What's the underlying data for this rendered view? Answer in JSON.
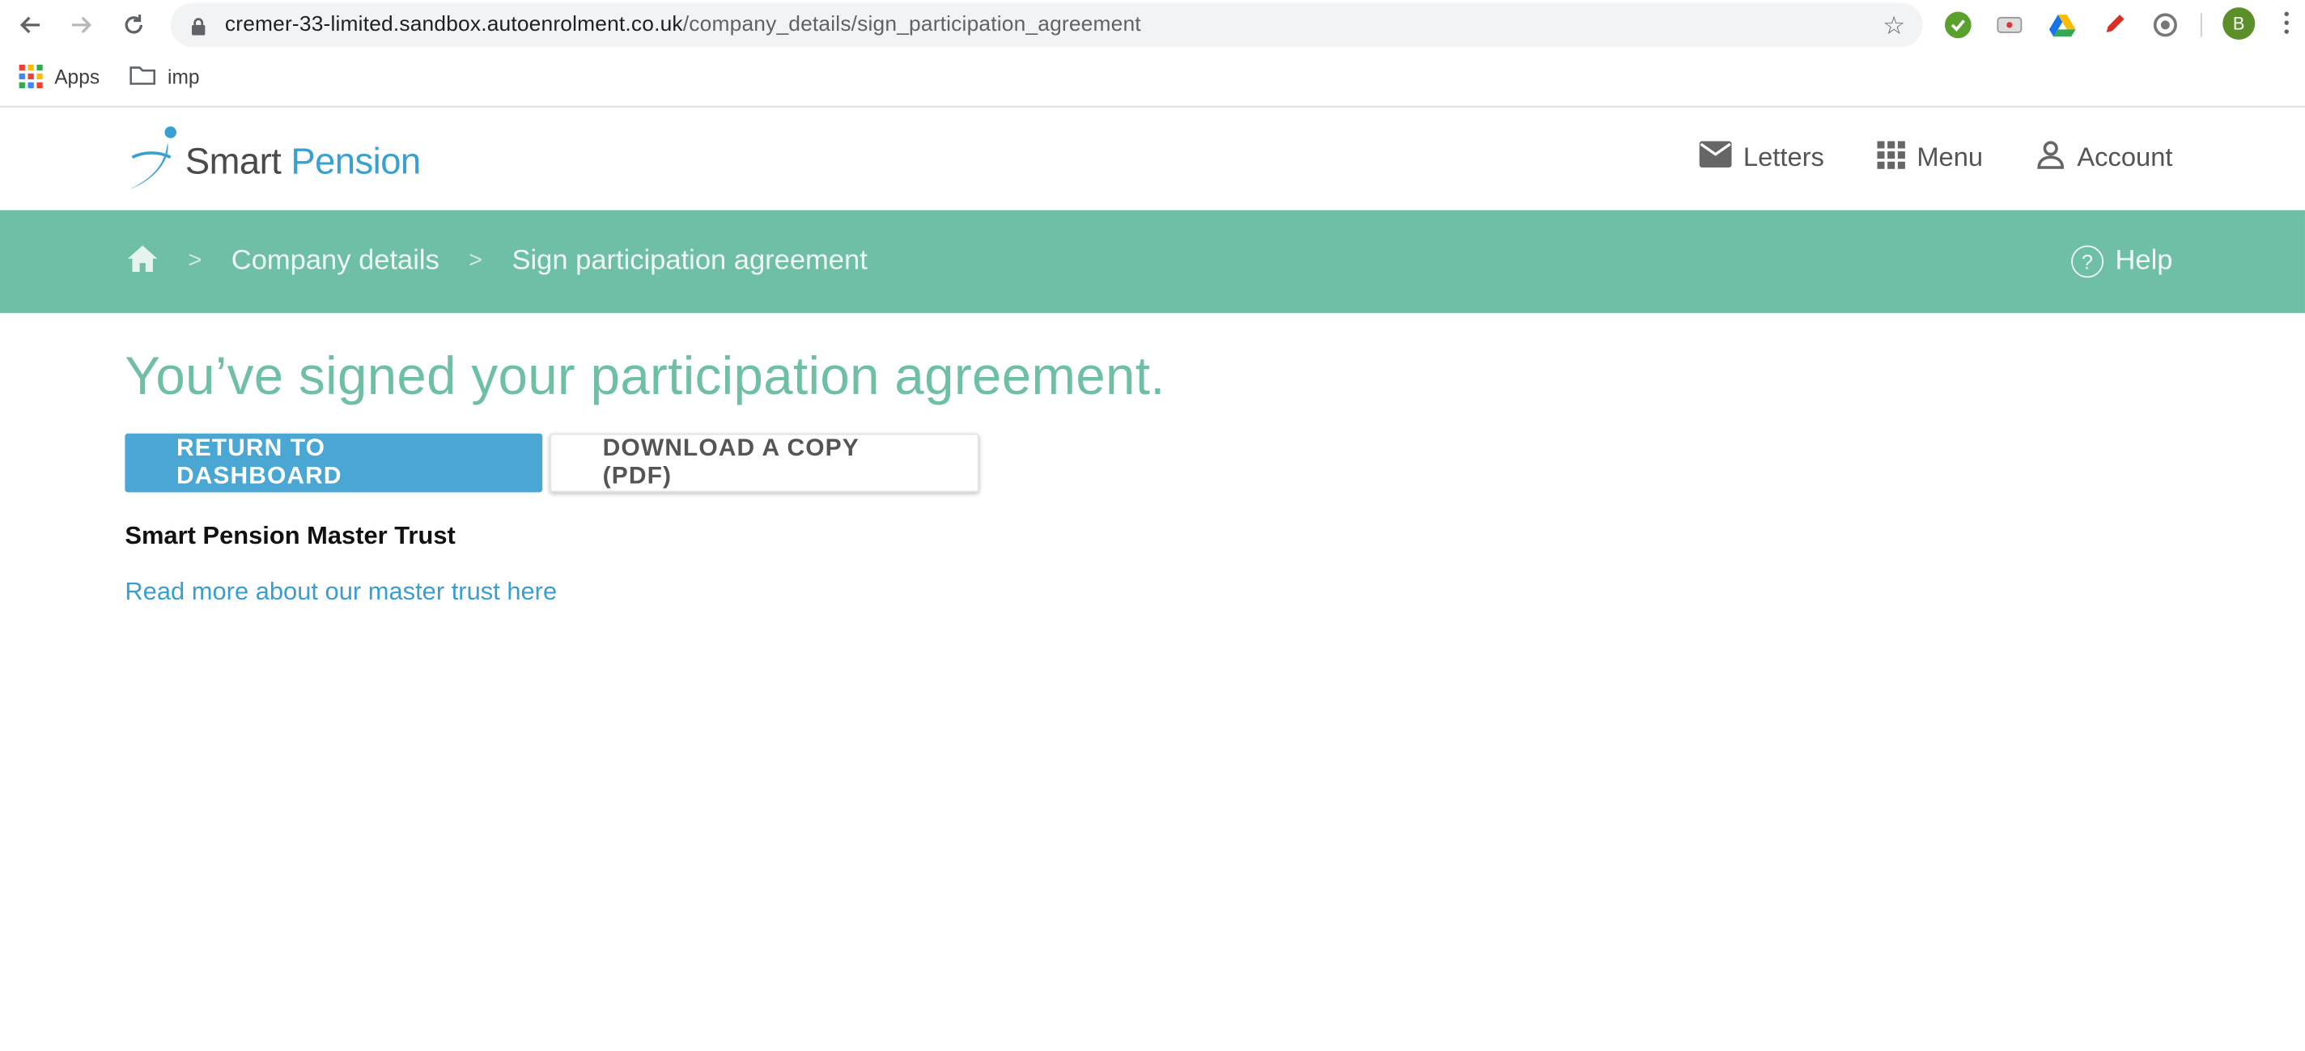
{
  "browser": {
    "url_host": "cremer-33-limited.sandbox.autoenrolment.co.uk",
    "url_path": "/company_details/sign_participation_agreement",
    "profile_initial": "B",
    "bookmarks": [
      {
        "label": "Apps",
        "icon": "apps-grid-icon"
      },
      {
        "label": "imp",
        "icon": "folder-icon"
      }
    ]
  },
  "header": {
    "logo_smart": "Smart",
    "logo_pension": "Pension",
    "nav": [
      {
        "label": "Letters",
        "icon": "mail-icon"
      },
      {
        "label": "Menu",
        "icon": "grid-menu-icon"
      },
      {
        "label": "Account",
        "icon": "person-icon"
      }
    ]
  },
  "breadcrumb": {
    "items": [
      "Company details",
      "Sign participation agreement"
    ],
    "help_label": "Help"
  },
  "main": {
    "title": "You’ve signed your participation agreement.",
    "primary_button": "RETURN TO DASHBOARD",
    "secondary_button": "DOWNLOAD A COPY (PDF)",
    "section_title": "Smart Pension Master Trust",
    "link_text": "Read more about our master trust here"
  },
  "colors": {
    "accent_green": "#6fbfa7",
    "primary_blue": "#4aa6d3",
    "link_blue": "#3a9ed0"
  }
}
